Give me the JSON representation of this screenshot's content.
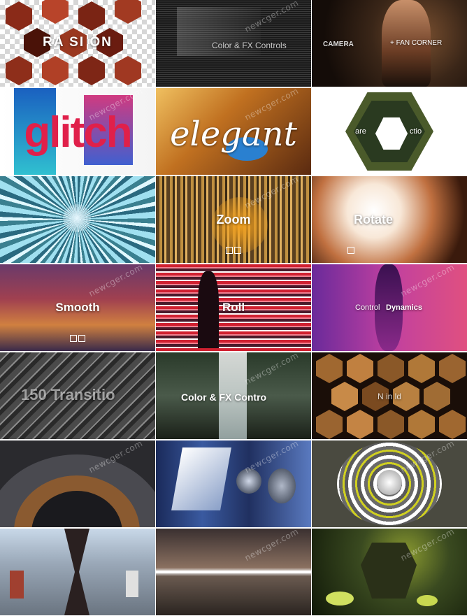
{
  "watermark": "newcger.com",
  "tiles": [
    {
      "id": "transition",
      "caption": "RA  SI  ON"
    },
    {
      "id": "color-fx-controls-1",
      "caption": "Color & FX Controls"
    },
    {
      "id": "camera-fan-corner",
      "caption_left": "CAMERA",
      "caption_right": "+ FAN CORNER"
    },
    {
      "id": "glitch",
      "caption": "glitch"
    },
    {
      "id": "elegant",
      "caption": "elegant"
    },
    {
      "id": "hex-badge",
      "caption_left": "are",
      "caption_right": "ctio"
    },
    {
      "id": "radial-blur",
      "caption": ""
    },
    {
      "id": "zoom",
      "caption": "Zoom"
    },
    {
      "id": "rotate",
      "caption": "Rotate"
    },
    {
      "id": "smooth",
      "caption": "Smooth"
    },
    {
      "id": "roll",
      "caption": "Roll"
    },
    {
      "id": "control-dynamics",
      "caption_left": "Control",
      "caption_right": "Dynamics"
    },
    {
      "id": "transitions-150",
      "caption": "150 Transitio"
    },
    {
      "id": "color-fx-controls-2",
      "caption": "Color & FX Contro"
    },
    {
      "id": "hex-gold",
      "caption": "N  in  ld"
    },
    {
      "id": "arc",
      "caption": ""
    },
    {
      "id": "blue-shapes",
      "caption": ""
    },
    {
      "id": "rings",
      "caption": ""
    },
    {
      "id": "skatepark",
      "caption": ""
    },
    {
      "id": "slice",
      "caption": ""
    },
    {
      "id": "green-scene",
      "caption": ""
    }
  ]
}
